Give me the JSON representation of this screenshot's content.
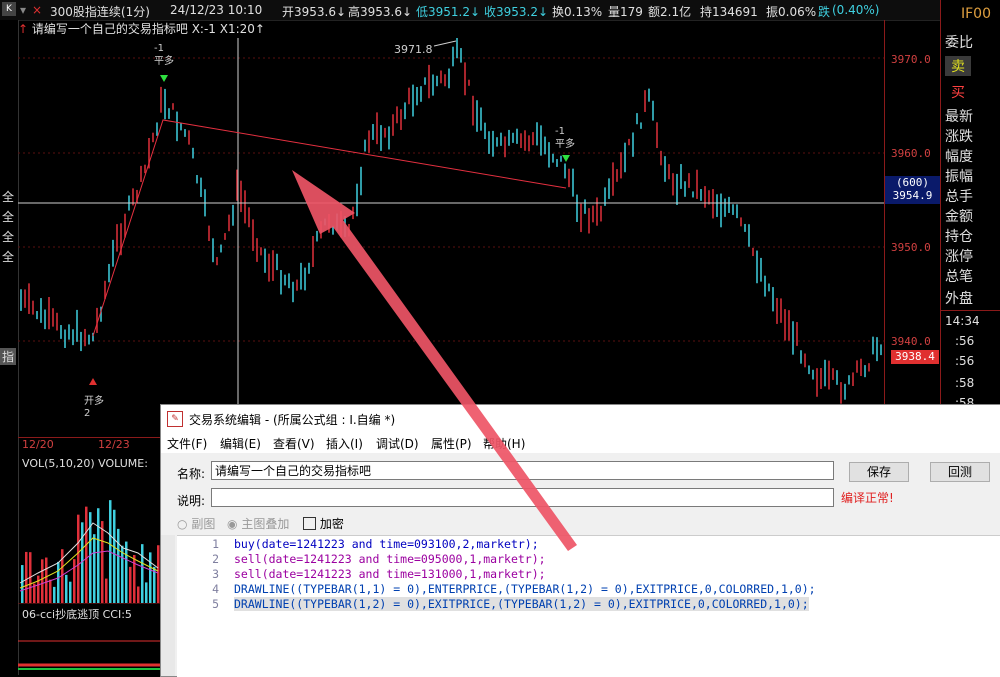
{
  "topbar": {
    "symbol": "300股指连续(1分)",
    "datetime": "24/12/23  10:10",
    "open": "开3953.6↓",
    "high": "高3953.6↓",
    "low": "低3951.2↓",
    "close": "收3953.2↓",
    "turnover": "换0.13%",
    "volume": "量179",
    "amount": "额2.1亿",
    "hold": "持134691",
    "amplitude": "振0.06%",
    "fall": "跌",
    "last": "(0.40%)",
    "code": "IF00"
  },
  "indicator_title": "请编写一个自己的交易指标吧 X:-1 X1:20↑",
  "side_labels": [
    "全",
    "全",
    "全",
    "全",
    "指"
  ],
  "price_ticks": [
    "3970.0",
    "3960.0",
    "3950.0",
    "3940.0"
  ],
  "crosshair_price": "(600)",
  "crosshair_price2": "3954.9",
  "current_price": "3938.4",
  "annotations": {
    "peak": "3971.8",
    "sig1_a": "-1",
    "sig1_b": "平多",
    "sig2_a": "-1",
    "sig2_b": "平多",
    "sig3_a": "开多",
    "sig3_b": "2"
  },
  "right_panel": {
    "items": [
      "委比",
      "卖",
      "买",
      "最新",
      "涨跌",
      "幅度",
      "振幅",
      "总手",
      "金额",
      "持仓",
      "涨停",
      "总笔",
      "外盘"
    ],
    "times": [
      "14:34",
      ":56",
      ":56",
      ":58",
      ":58"
    ]
  },
  "date_labels": [
    "12/20",
    "12/23"
  ],
  "vol_title": "VOL(5,10,20) VOLUME:",
  "cci_title": "06-cci抄底逃顶 CCI:5",
  "dialog": {
    "title": "交易系统编辑 - (所属公式组 : I.自编 *)",
    "menu": [
      "文件(F)",
      "编辑(E)",
      "查看(V)",
      "插入(I)",
      "调试(D)",
      "属性(P)",
      "帮助(H)"
    ],
    "name_label": "名称:",
    "name_value": "请编写一个自己的交易指标吧",
    "desc_label": "说明:",
    "desc_value": "",
    "save": "保存",
    "back": "回测",
    "status": "编译正常!",
    "opt_sub": "副图",
    "opt_main": "主图叠加",
    "opt_encrypt": "加密",
    "code_lines": [
      "buy(date=1241223 and time=093100,2,marketr);",
      "sell(date=1241223 and time=095000,1,marketr);",
      "sell(date=1241223 and time=131000,1,marketr);",
      "DRAWLINE((TYPEBAR(1,1) = 0),ENTERPRICE,(TYPEBAR(1,2) = 0),EXITPRICE,0,COLORRED,1,0);",
      "DRAWLINE((TYPEBAR(1,2) = 0),EXITPRICE,(TYPEBAR(1,2) = 0),EXITPRICE,0,COLORRED,1,0);"
    ],
    "line_numbers": [
      "1",
      "2",
      "3",
      "4",
      "5"
    ]
  },
  "colors": {
    "up": "#e0303a",
    "down": "#3fd0e0",
    "axis": "#8b1a1a",
    "arrow": "#ee5566"
  }
}
